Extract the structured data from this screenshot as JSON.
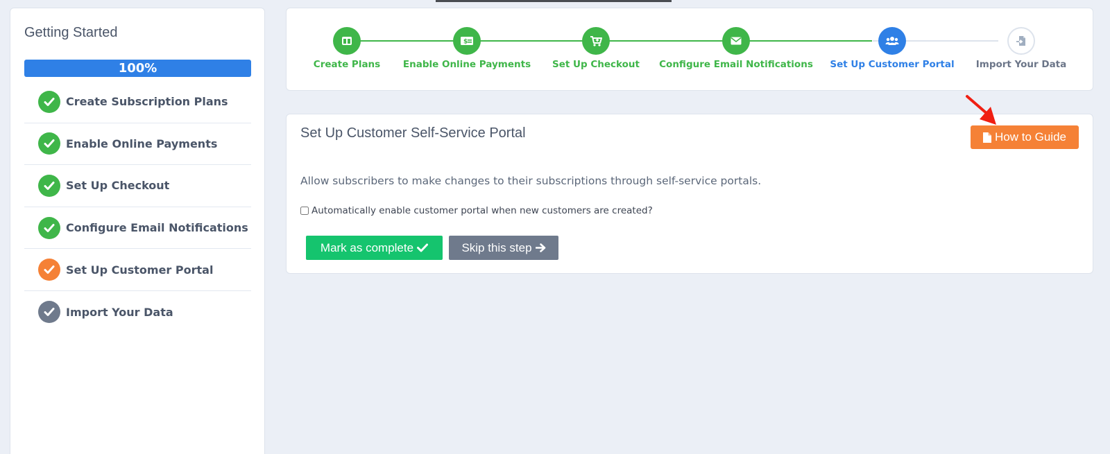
{
  "sidebar": {
    "title": "Getting Started",
    "progress": {
      "label": "100%",
      "percent": 100
    },
    "items": [
      {
        "label": "Create Subscription Plans",
        "status": "complete"
      },
      {
        "label": "Enable Online Payments",
        "status": "complete"
      },
      {
        "label": "Set Up Checkout",
        "status": "complete"
      },
      {
        "label": "Configure Email Notifications",
        "status": "complete"
      },
      {
        "label": "Set Up Customer Portal",
        "status": "current"
      },
      {
        "label": "Import Your Data",
        "status": "pending"
      }
    ]
  },
  "stepper": {
    "steps": [
      {
        "label": "Create Plans",
        "icon": "plans-icon",
        "state": "done"
      },
      {
        "label": "Enable Online Payments",
        "icon": "money-icon",
        "state": "done"
      },
      {
        "label": "Set Up Checkout",
        "icon": "cart-icon",
        "state": "done"
      },
      {
        "label": "Configure Email Notifications",
        "icon": "envelope-icon",
        "state": "done"
      },
      {
        "label": "Set Up Customer Portal",
        "icon": "users-icon",
        "state": "active"
      },
      {
        "label": "Import Your Data",
        "icon": "file-import-icon",
        "state": "todo"
      }
    ]
  },
  "main": {
    "title": "Set Up Customer Self-Service Portal",
    "guide_button": "How to Guide",
    "description": "Allow subscribers to make changes to their subscriptions through self-service portals.",
    "checkbox_label": "Automatically enable customer portal when new customers are created?",
    "checkbox_checked": false,
    "complete_button": "Mark as complete",
    "skip_button": "Skip this step"
  },
  "colors": {
    "done": "#3fb649",
    "active": "#2f80e6",
    "current_orange": "#f58136",
    "pending_gray": "#6f7a8c",
    "complete_green": "#15c46e",
    "annotation_red": "#f01f12"
  }
}
